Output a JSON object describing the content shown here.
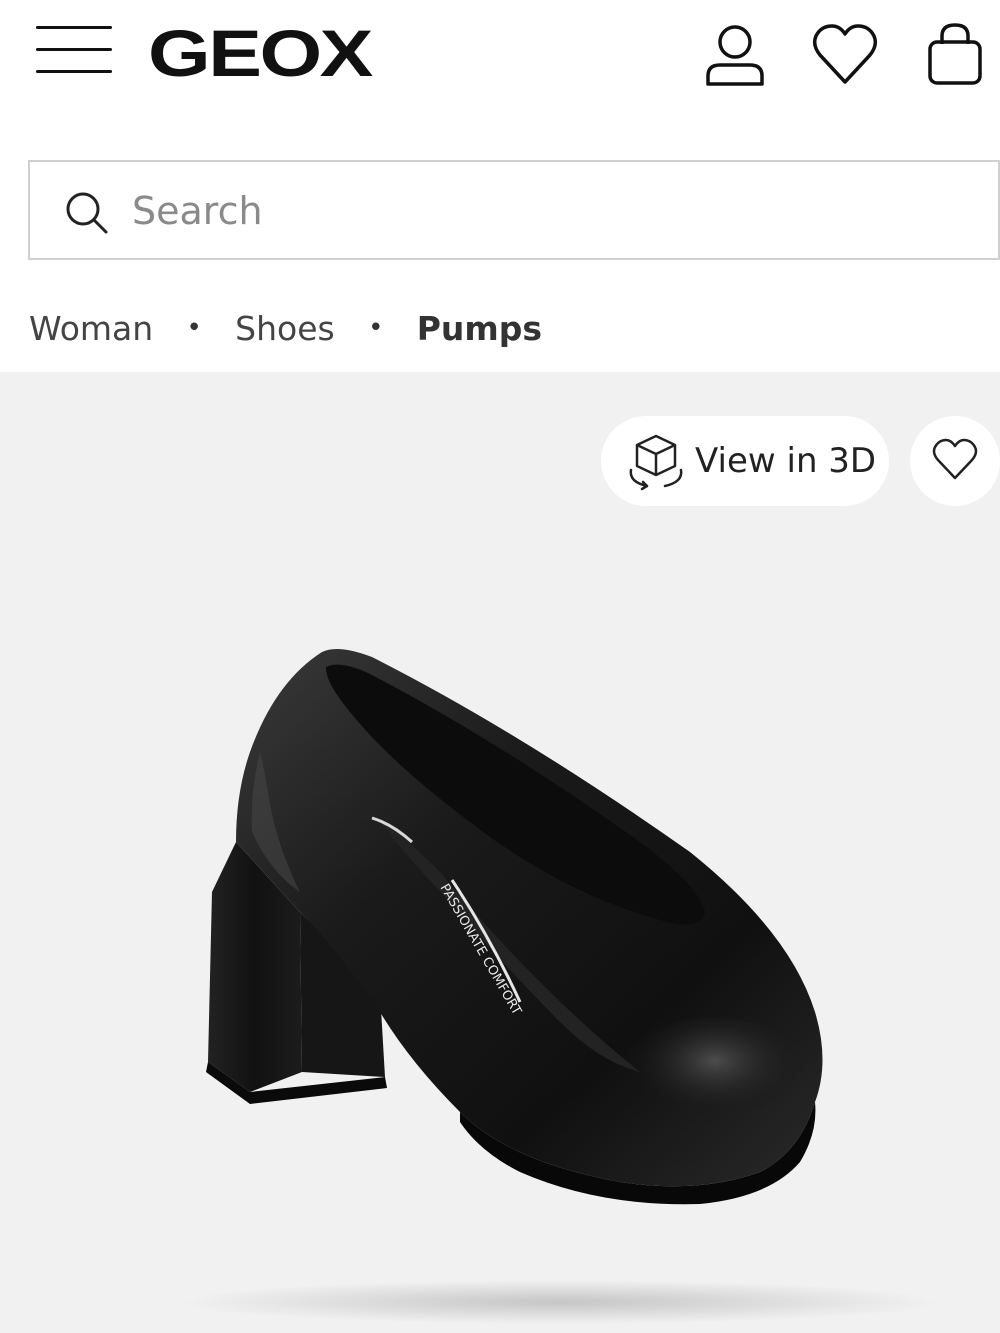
{
  "header": {
    "menu_icon": "hamburger-menu-icon",
    "logo_text": "GEOX",
    "account_icon": "user-icon",
    "wishlist_icon": "heart-icon",
    "cart_icon": "shopping-bag-icon"
  },
  "search": {
    "placeholder": "Search",
    "value": "",
    "icon": "search-icon"
  },
  "breadcrumb": {
    "items": [
      "Woman",
      "Shoes",
      "Pumps"
    ],
    "separator": "•"
  },
  "product_gallery": {
    "view_3d_label": "View in 3D",
    "view_3d_icon": "3d-cube-rotate-icon",
    "wishlist_icon": "heart-icon",
    "insole_text": "PASSIONATE COMFORT",
    "background_color": "#f1f1f1",
    "shoe_color": "#141414"
  }
}
